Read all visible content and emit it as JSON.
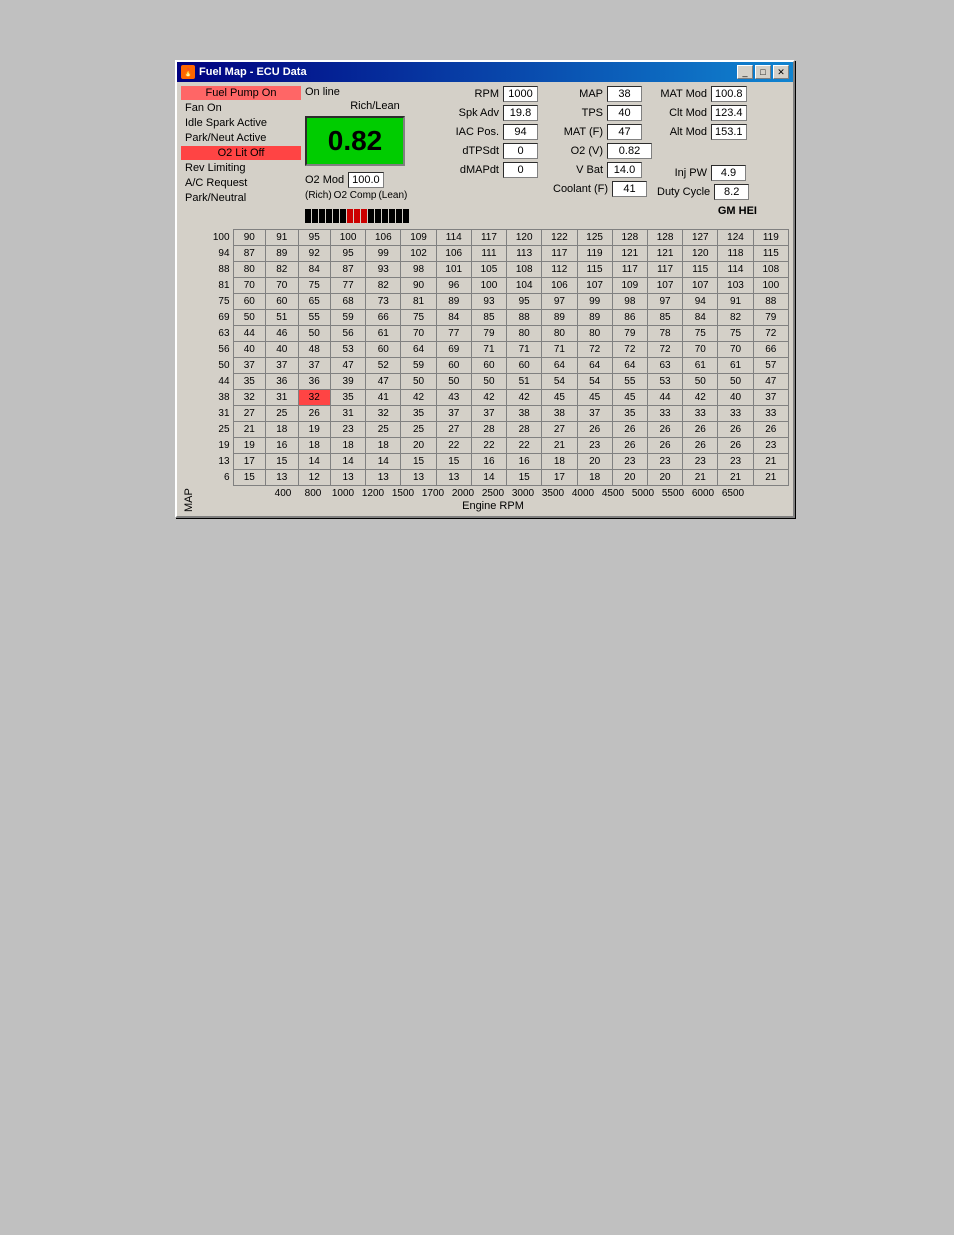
{
  "window": {
    "title": "Fuel Map - ECU Data",
    "icon": "🔥"
  },
  "titlebar": {
    "minimize": "_",
    "maximize": "□",
    "close": "✕"
  },
  "status": {
    "online": "On line",
    "rich_lean": "Rich/Lean",
    "fuel_pump": "Fuel Pump On",
    "fan_on": "Fan On",
    "idle_spark": "Idle Spark Active",
    "park_neut": "Park/Neut Active",
    "o2_lit": "O2 Lit Off",
    "rev_limiting": "Rev Limiting",
    "ac_request": "A/C Request",
    "park_neutral": "Park/Neutral"
  },
  "big_display": {
    "value": "0.82"
  },
  "o2_mod": {
    "label": "O2 Mod",
    "value": "100.0",
    "rich": "(Rich)",
    "comp": "O2 Comp",
    "lean": "(Lean)"
  },
  "sensors": {
    "rpm_label": "RPM",
    "rpm_value": "1000",
    "spk_adv_label": "Spk Adv",
    "spk_adv_value": "19.8",
    "iac_pos_label": "IAC Pos.",
    "iac_pos_value": "94",
    "dtpsdt_label": "dTPSdt",
    "dtpsdt_value": "0",
    "dmapdt_label": "dMAPdt",
    "dmapdt_value": "0"
  },
  "right_sensors": {
    "map_label": "MAP",
    "map_value": "38",
    "tps_label": "TPS",
    "tps_value": "40",
    "mat_f_label": "MAT (F)",
    "mat_f_value": "47",
    "o2v_label": "O2 (V)",
    "o2v_value": "0.82",
    "vbat_label": "V Bat",
    "vbat_value": "14.0",
    "coolant_f_label": "Coolant (F)",
    "coolant_f_value": "41"
  },
  "far_right": {
    "mat_mod_label": "MAT Mod",
    "mat_mod_value": "100.8",
    "clt_mod_label": "Clt Mod",
    "clt_mod_value": "123.4",
    "alt_mod_label": "Alt Mod",
    "alt_mod_value": "153.1",
    "inj_pw_label": "Inj PW",
    "inj_pw_value": "4.9",
    "duty_cycle_label": "Duty Cycle",
    "duty_cycle_value": "8.2",
    "gm_hei": "GM HEI"
  },
  "map_axis": {
    "label": "MAP",
    "rows": [
      100,
      94,
      88,
      81,
      75,
      69,
      63,
      56,
      50,
      44,
      38,
      31,
      25,
      19,
      13,
      6
    ]
  },
  "rpm_axis": {
    "label": "Engine RPM",
    "cols": [
      "400",
      "800",
      "1000",
      "1200",
      "1500",
      "1700",
      "2000",
      "2500",
      "3000",
      "3500",
      "4000",
      "4500",
      "5000",
      "5500",
      "6000",
      "6500"
    ]
  },
  "fuel_map": [
    [
      90,
      91,
      95,
      100,
      106,
      109,
      114,
      117,
      120,
      122,
      125,
      128,
      128,
      127,
      124,
      119
    ],
    [
      87,
      89,
      92,
      95,
      99,
      102,
      106,
      111,
      113,
      117,
      119,
      121,
      121,
      120,
      118,
      115
    ],
    [
      80,
      82,
      84,
      87,
      93,
      98,
      101,
      105,
      108,
      112,
      115,
      117,
      117,
      115,
      114,
      108
    ],
    [
      70,
      70,
      75,
      77,
      82,
      90,
      96,
      100,
      104,
      106,
      107,
      109,
      107,
      107,
      103,
      100
    ],
    [
      60,
      60,
      65,
      68,
      73,
      81,
      89,
      93,
      95,
      97,
      99,
      98,
      97,
      94,
      91,
      88
    ],
    [
      50,
      51,
      55,
      59,
      66,
      75,
      84,
      85,
      88,
      89,
      89,
      86,
      85,
      84,
      82,
      79
    ],
    [
      44,
      46,
      50,
      56,
      61,
      70,
      77,
      79,
      80,
      80,
      80,
      79,
      78,
      75,
      75,
      72
    ],
    [
      40,
      40,
      48,
      53,
      60,
      64,
      69,
      71,
      71,
      71,
      72,
      72,
      72,
      70,
      70,
      66
    ],
    [
      37,
      37,
      37,
      47,
      52,
      59,
      60,
      60,
      60,
      64,
      64,
      64,
      63,
      61,
      61,
      57
    ],
    [
      35,
      36,
      36,
      39,
      47,
      50,
      50,
      50,
      51,
      54,
      54,
      55,
      53,
      50,
      50,
      47
    ],
    [
      32,
      31,
      32,
      35,
      41,
      42,
      43,
      42,
      42,
      45,
      45,
      45,
      44,
      42,
      40,
      37
    ],
    [
      27,
      25,
      26,
      31,
      32,
      35,
      37,
      37,
      38,
      38,
      37,
      35,
      33,
      33,
      33,
      33
    ],
    [
      21,
      18,
      19,
      23,
      25,
      25,
      27,
      28,
      28,
      27,
      26,
      26,
      26,
      26,
      26,
      26
    ],
    [
      19,
      16,
      18,
      18,
      18,
      20,
      22,
      22,
      22,
      21,
      23,
      26,
      26,
      26,
      26,
      23
    ],
    [
      17,
      15,
      14,
      14,
      14,
      15,
      15,
      16,
      16,
      18,
      20,
      23,
      23,
      23,
      23,
      21
    ],
    [
      15,
      13,
      12,
      13,
      13,
      13,
      13,
      14,
      15,
      17,
      18,
      20,
      20,
      21,
      21,
      21
    ]
  ],
  "highlighted_cell": {
    "row": 10,
    "col": 2
  }
}
